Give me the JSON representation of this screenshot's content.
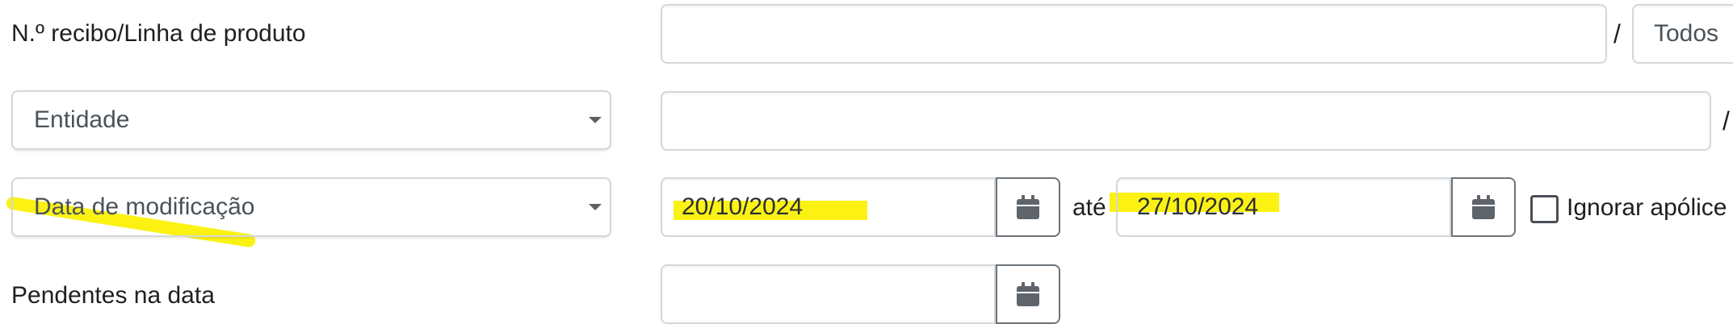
{
  "row1": {
    "label": "N.º recibo/Linha de produto",
    "receipt_value": "",
    "separator": "/",
    "product_line_value": "Todos"
  },
  "row2": {
    "entity_select": "Entidade",
    "entity_value": "",
    "separator": "/"
  },
  "row3": {
    "date_type_select": "Data de modificação",
    "date_from": "20/10/2024",
    "until_label": "até",
    "date_to": "27/10/2024",
    "ignore_checkbox_label": "Ignorar apólice"
  },
  "row4": {
    "label": "Pendentes na data",
    "pending_date_value": ""
  },
  "icons": {
    "calendar": "calendar-icon",
    "dropdown": "chevron-down-icon",
    "checkbox": "checkbox-unchecked-icon"
  },
  "colors": {
    "highlight": "#fbf100",
    "input_border": "#d4d7da",
    "button_border": "#6c7379",
    "icon": "#5e646a"
  }
}
